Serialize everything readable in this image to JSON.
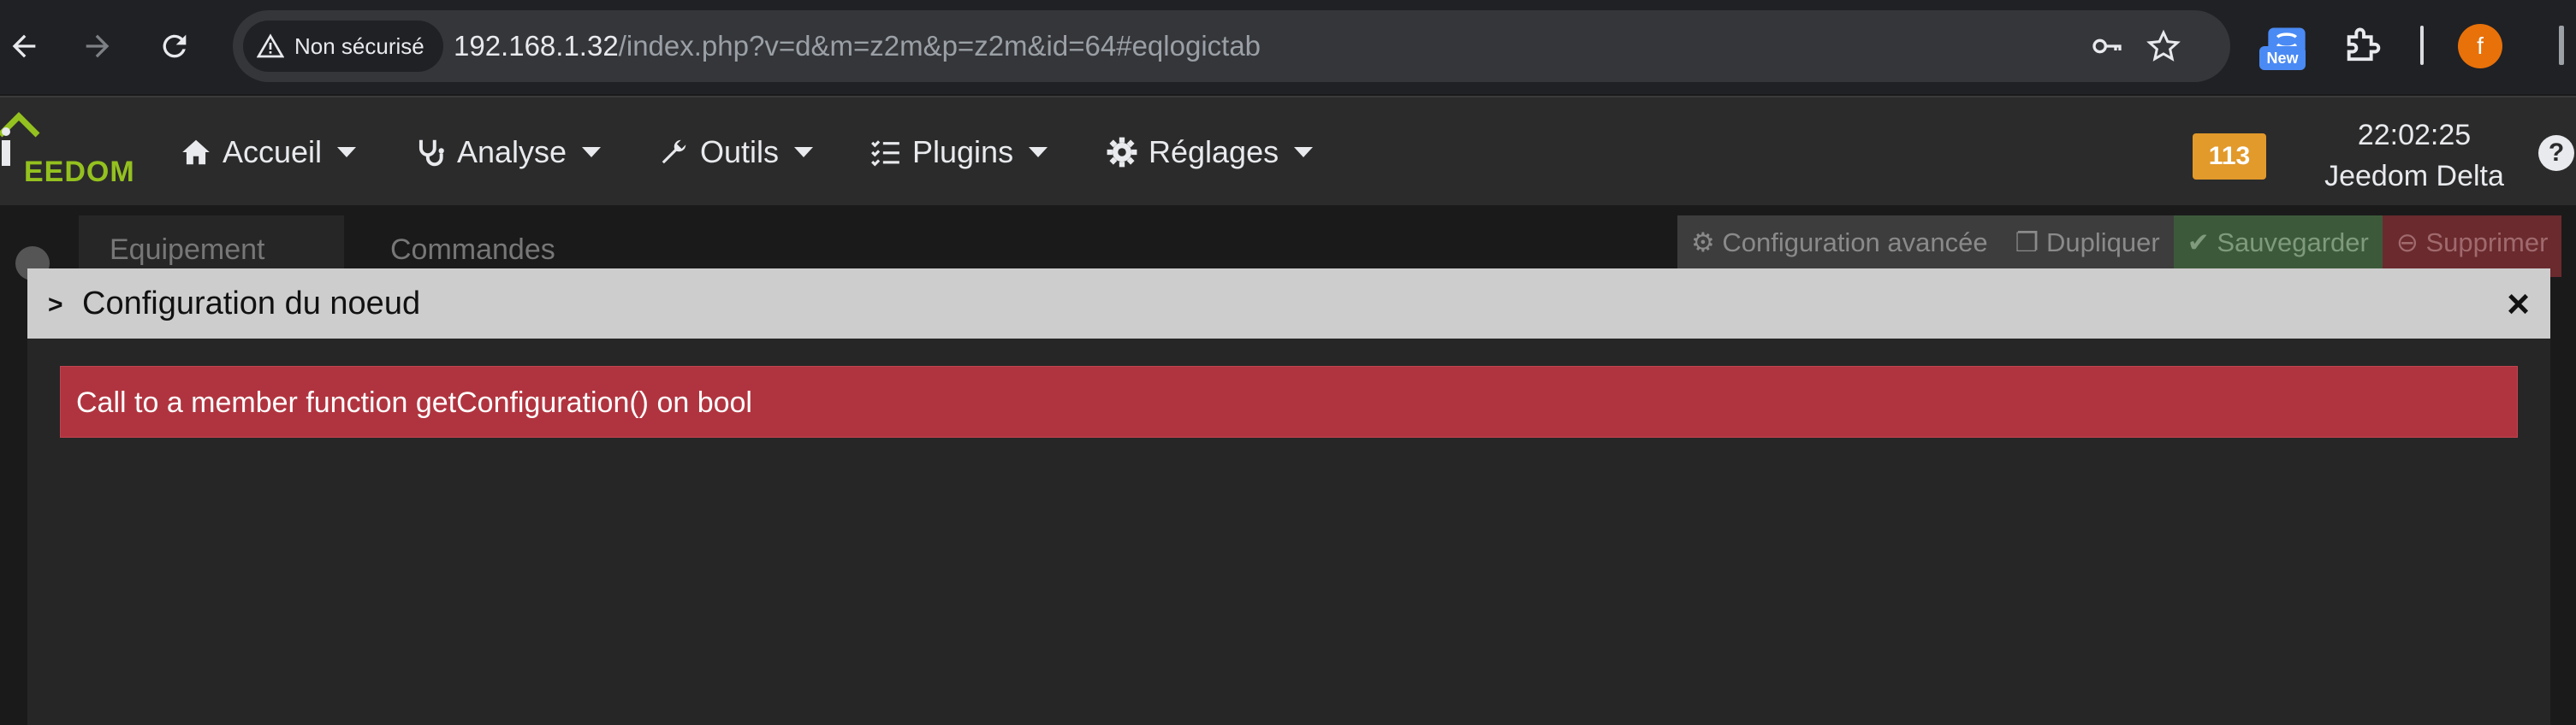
{
  "browser": {
    "security_label": "Non sécurisé",
    "url_host": "192.168.1.32",
    "url_path": "/index.php?v=d&m=z2m&p=z2m&id=64#eqlogictab",
    "new_badge": "New",
    "avatar_letter": "f"
  },
  "navbar": {
    "logo_text": "EEDOM",
    "menu": [
      {
        "label": "Accueil",
        "icon": "home-icon"
      },
      {
        "label": "Analyse",
        "icon": "stethoscope-icon"
      },
      {
        "label": "Outils",
        "icon": "wrench-icon"
      },
      {
        "label": "Plugins",
        "icon": "checklist-icon"
      },
      {
        "label": "Réglages",
        "icon": "gear-icon"
      }
    ],
    "message_count": "113",
    "time": "22:02:25",
    "system_name": "Jeedom Delta"
  },
  "page": {
    "tabs": [
      "Equipement",
      "Commandes"
    ],
    "actions": {
      "advanced": "Configuration avancée",
      "duplicate": "Dupliquer",
      "save": "Sauvegarder",
      "delete": "Supprimer"
    }
  },
  "modal": {
    "title": "Configuration du noeud",
    "close": "×",
    "error": "Call to a member function getConfiguration() on bool"
  },
  "colors": {
    "accent_green": "#94c11f",
    "badge_orange": "#e29a2b",
    "alert_red": "#b0343f"
  }
}
